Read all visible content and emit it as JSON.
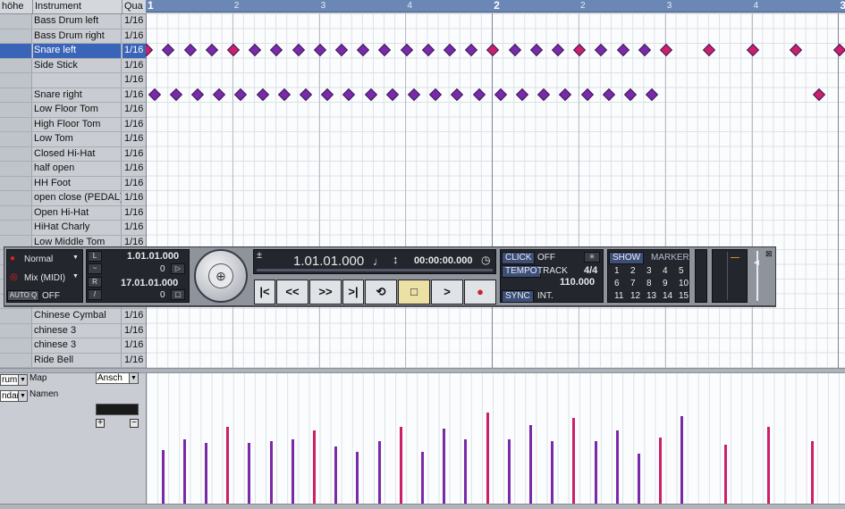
{
  "header": {
    "col0": "höhe",
    "col1": "Instrument",
    "col2": "Qua"
  },
  "instruments": [
    {
      "name": "Bass Drum left",
      "quant": "1/16"
    },
    {
      "name": "Bass Drum right",
      "quant": "1/16"
    },
    {
      "name": "Snare left",
      "quant": "1/16",
      "selected": true
    },
    {
      "name": "Side Stick",
      "quant": "1/16"
    },
    {
      "name": "",
      "quant": "1/16"
    },
    {
      "name": "Snare right",
      "quant": "1/16"
    },
    {
      "name": "Low Floor Tom",
      "quant": "1/16"
    },
    {
      "name": "High Floor Tom",
      "quant": "1/16"
    },
    {
      "name": "Low Tom",
      "quant": "1/16"
    },
    {
      "name": "Closed Hi-Hat",
      "quant": "1/16"
    },
    {
      "name": "half open",
      "quant": "1/16"
    },
    {
      "name": "HH Foot",
      "quant": "1/16"
    },
    {
      "name": "open close (PEDAL)",
      "quant": "1/16"
    },
    {
      "name": "Open Hi-Hat",
      "quant": "1/16"
    },
    {
      "name": "HiHat Charly",
      "quant": "1/16"
    },
    {
      "name": "Low Middle Tom",
      "quant": "1/16"
    },
    {
      "name": "",
      "quant": ""
    },
    {
      "name": "",
      "quant": ""
    },
    {
      "name": "",
      "quant": ""
    },
    {
      "name": "",
      "quant": ""
    },
    {
      "name": "Chinese Cymbal",
      "quant": "1/16"
    },
    {
      "name": "chinese 3",
      "quant": "1/16"
    },
    {
      "name": "chinese 3",
      "quant": "1/16"
    },
    {
      "name": "Ride Bell",
      "quant": "1/16"
    }
  ],
  "ruler": {
    "marks": [
      {
        "label": "1",
        "bar": true
      },
      {
        "label": "2",
        "bar": false
      },
      {
        "label": "3",
        "bar": false
      },
      {
        "label": "4",
        "bar": false
      },
      {
        "label": "2",
        "bar": true
      },
      {
        "label": "2",
        "bar": false
      },
      {
        "label": "3",
        "bar": false
      },
      {
        "label": "4",
        "bar": false
      },
      {
        "label": "3",
        "bar": true
      }
    ]
  },
  "bottom_left": {
    "drum_map_value": "rum",
    "map_label": "Map",
    "display_value": "Ansch",
    "names_value": "ndar",
    "names_label": "Namen",
    "plus": "+",
    "minus": "−"
  },
  "transport": {
    "mode": "Normal",
    "mix": "Mix (MIDI)",
    "auto_q": "AUTO Q",
    "auto_q_state": "OFF",
    "left_locator": "1.01.01.000",
    "left_offset": "0",
    "right_locator": "17.01.01.000",
    "right_offset": "0",
    "position_bars": "1.01.01.000",
    "position_time": "00:00:00.000",
    "click_label": "CLICK",
    "click_state": "OFF",
    "tempo_label": "TEMPO",
    "track_label": "TRACK",
    "signature": "4/4",
    "tempo_value": "110.000",
    "sync_label": "SYNC",
    "sync_state": "INT.",
    "show_label": "SHOW",
    "marker_label": "MARKER",
    "markers": [
      "1",
      "2",
      "3",
      "4",
      "5",
      "6",
      "7",
      "8",
      "9",
      "10",
      "11",
      "12",
      "13",
      "14",
      "15"
    ],
    "buttons": {
      "go_start": "|<",
      "rewind": "<<",
      "forward": ">>",
      "go_end": ">|",
      "cycle": "⟲",
      "stop": "□",
      "play": ">",
      "record": "●"
    }
  },
  "colors": {
    "note_magenta": "#cc1f6a",
    "note_purple": "#7a2aa8",
    "selection": "#3a64b8",
    "ruler": "#6b87b6"
  }
}
